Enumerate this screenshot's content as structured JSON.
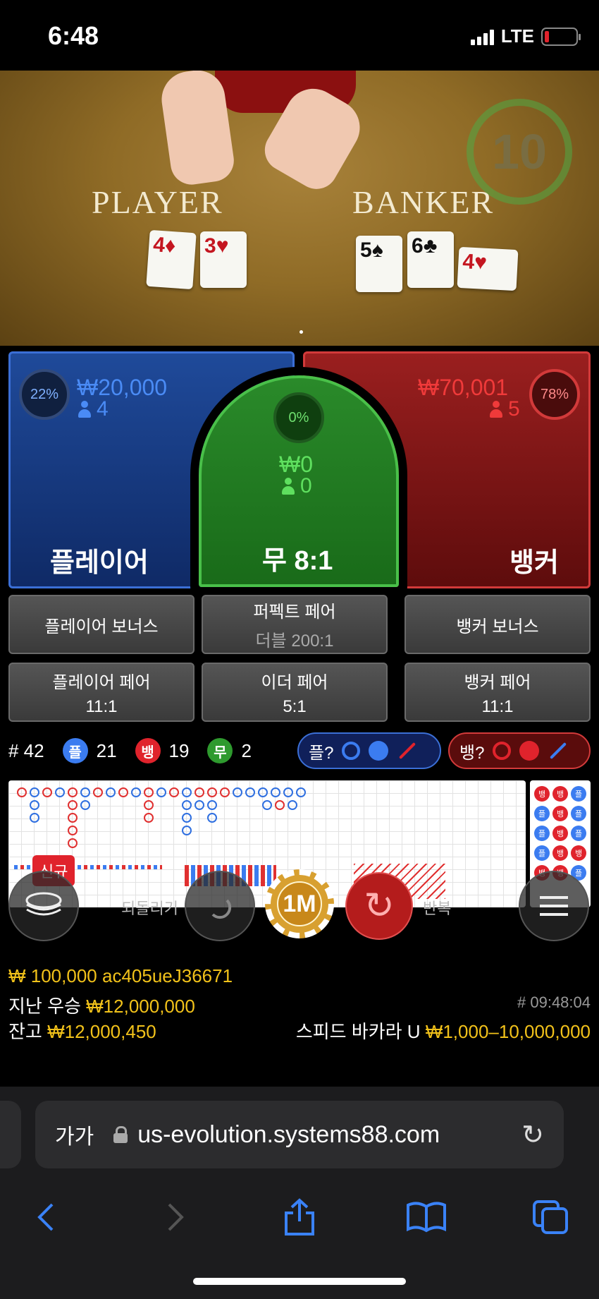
{
  "status_bar": {
    "time": "6:48",
    "network": "LTE"
  },
  "table": {
    "player_label": "PLAYER",
    "banker_label": "BANKER",
    "timer": "10",
    "player_cards": [
      {
        "rank": "4",
        "suit": "♦",
        "color": "red"
      },
      {
        "rank": "3",
        "suit": "♥",
        "color": "red"
      }
    ],
    "banker_cards": [
      {
        "rank": "5",
        "suit": "♠",
        "color": "black"
      },
      {
        "rank": "6",
        "suit": "♣",
        "color": "black"
      },
      {
        "rank": "4",
        "suit": "♥",
        "color": "red"
      }
    ]
  },
  "bets": {
    "player": {
      "percent": "22%",
      "amount": "₩20,000",
      "count": "4",
      "title": "플레이어"
    },
    "tie": {
      "percent": "0%",
      "amount": "₩0",
      "count": "0",
      "title": "무 8:1"
    },
    "banker": {
      "percent": "78%",
      "amount": "₩70,001",
      "count": "5",
      "title": "뱅커"
    }
  },
  "side_bets": {
    "player_bonus": "플레이어 보너스",
    "perfect_pair": "퍼펙트 페어",
    "perfect_pair_sub": "더블 200:1",
    "banker_bonus": "뱅커 보너스",
    "player_pair": "플레이어 페어",
    "player_pair_odds": "11:1",
    "either_pair": "이더 페어",
    "either_pair_odds": "5:1",
    "banker_pair": "뱅커 페어",
    "banker_pair_odds": "11:1"
  },
  "stats": {
    "round": "# 42",
    "player_badge": "플",
    "player_wins": "21",
    "banker_badge": "뱅",
    "banker_wins": "19",
    "tie_badge": "무",
    "ties": "2",
    "player_predict": "플?",
    "banker_predict": "뱅?"
  },
  "roadmap": {
    "new_tag": "신규"
  },
  "controls": {
    "undo_label": "되돌리기",
    "chip_value": "1M",
    "repeat_label": "반복"
  },
  "info": {
    "bet_line_amount": "₩ 100,000",
    "user_id": "ac405ueJ36671",
    "last_win_label": "지난 우승",
    "last_win_amount": "₩12,000,000",
    "game_id": "# 09:48:04",
    "balance_label": "잔고",
    "balance_amount": "₩12,000,450",
    "game_name": "스피드 바카라 U",
    "limits": "₩1,000–10,000,000"
  },
  "browser": {
    "text_size": "가가",
    "url": "us-evolution.systems88.com"
  },
  "colors": {
    "player_blue": "#3b7cf0",
    "banker_red": "#e0232c",
    "tie_green": "#3cc03c",
    "gold": "#f2c21a"
  }
}
